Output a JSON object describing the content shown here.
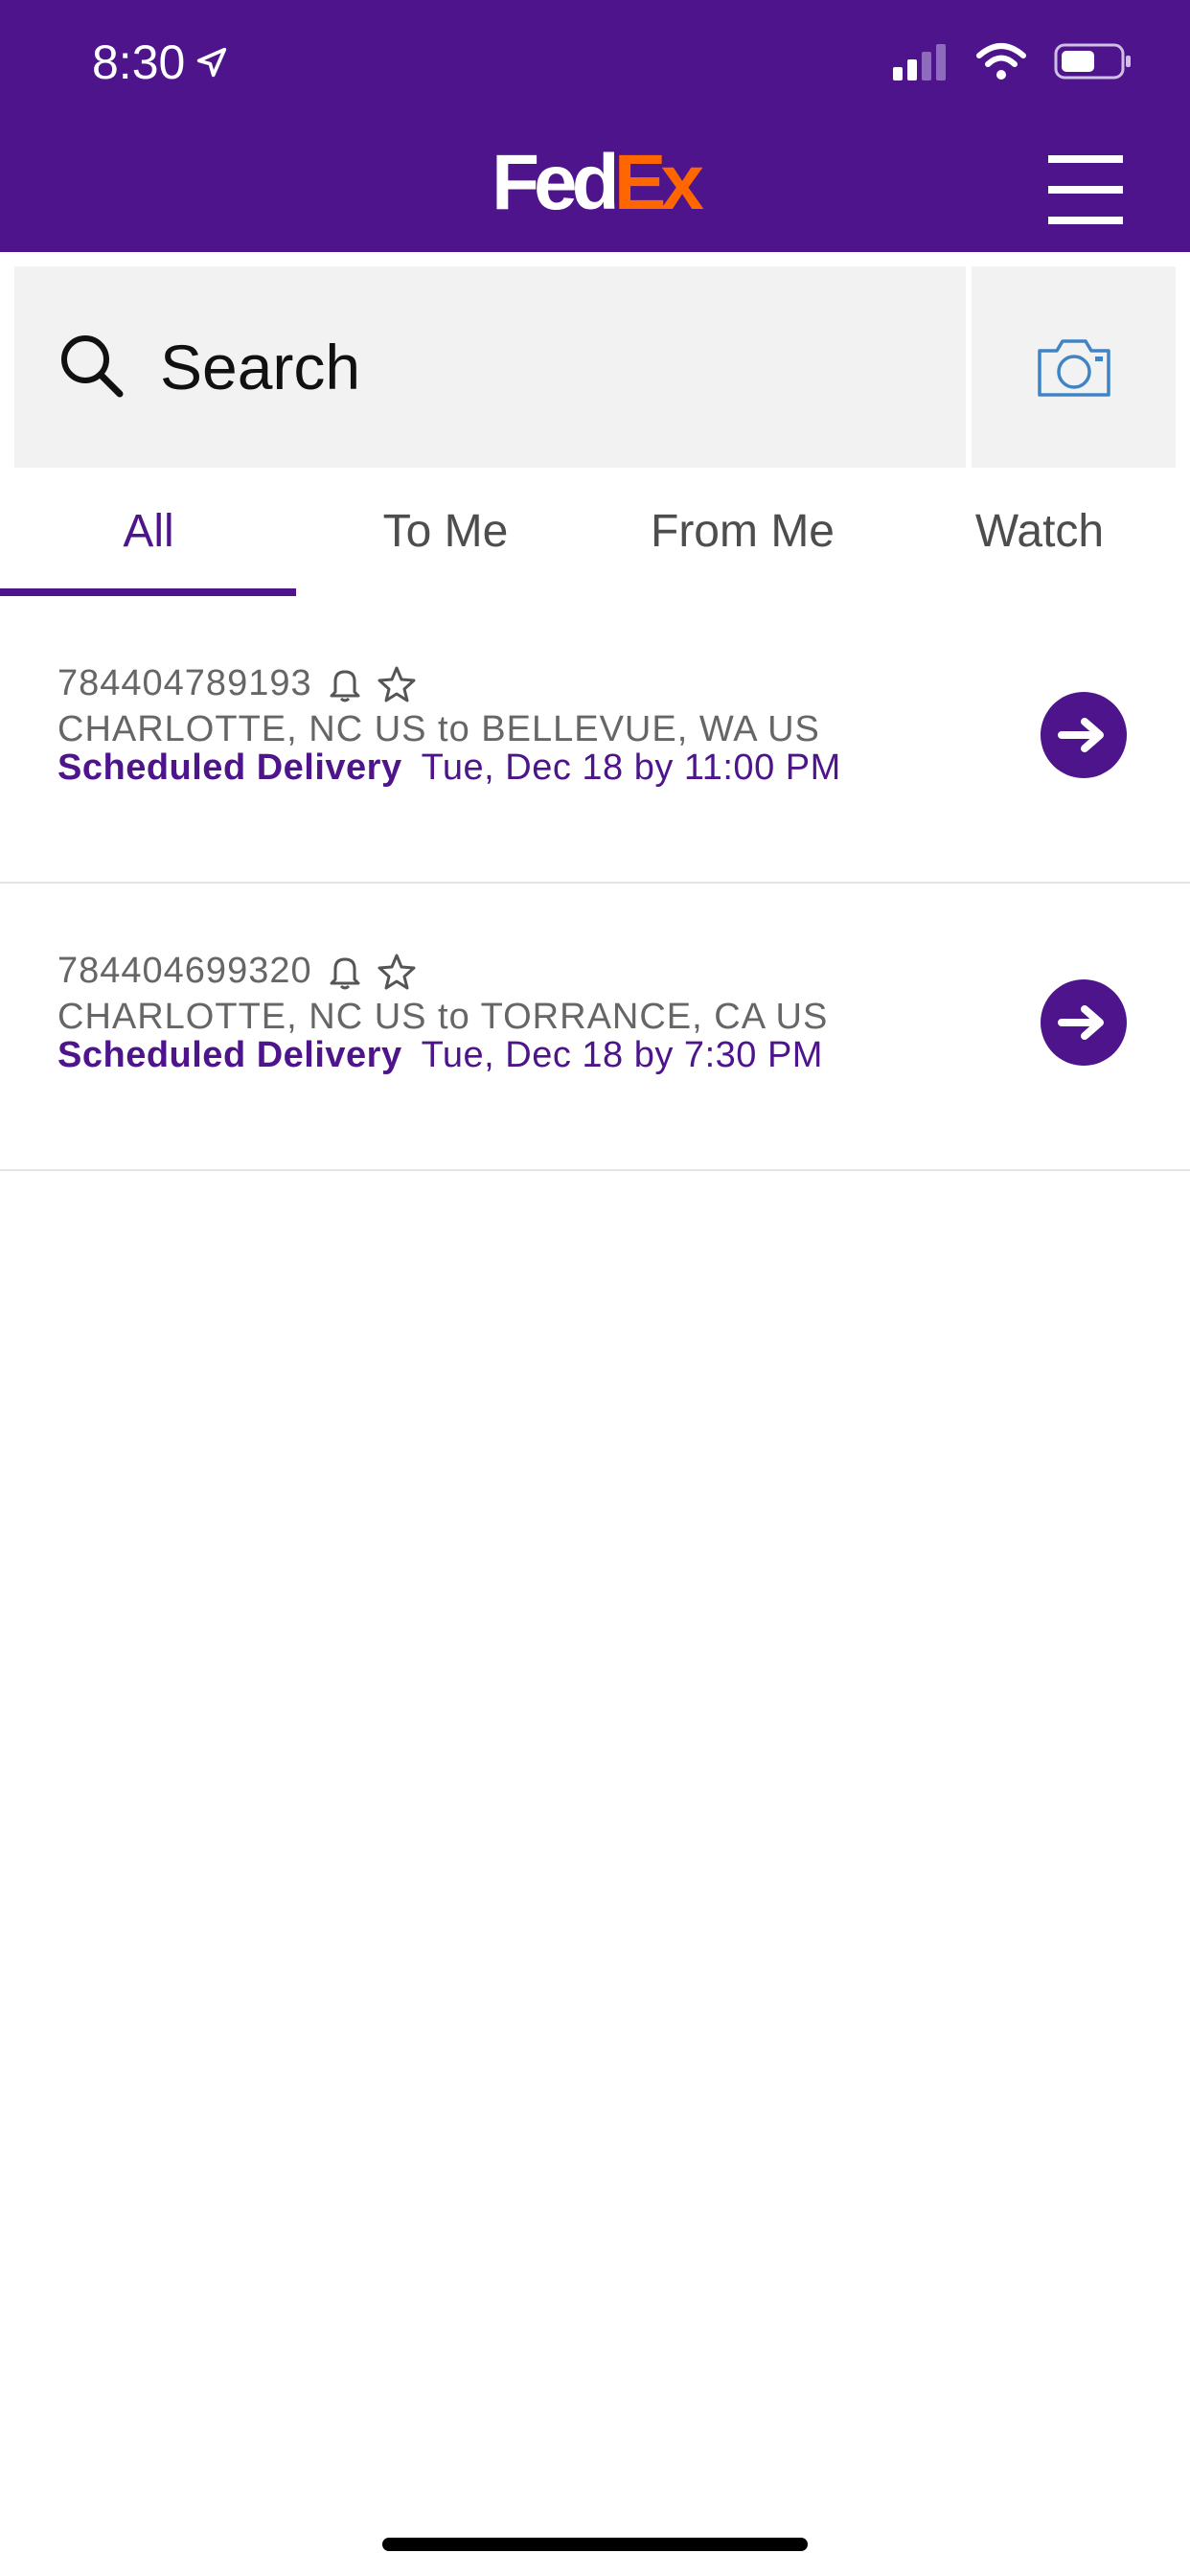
{
  "status_bar": {
    "time": "8:30"
  },
  "header": {
    "logo_fed": "Fed",
    "logo_ex": "Ex",
    "brand_purple": "#4d148c",
    "brand_orange": "#ff6600"
  },
  "search": {
    "placeholder": "Search"
  },
  "tabs": [
    {
      "label": "All",
      "active": true
    },
    {
      "label": "To Me",
      "active": false
    },
    {
      "label": "From Me",
      "active": false
    },
    {
      "label": "Watch",
      "active": false
    }
  ],
  "shipments": [
    {
      "tracking": "784404789193",
      "route": "CHARLOTTE, NC US to BELLEVUE, WA US",
      "status": "Scheduled Delivery",
      "when": "Tue, Dec 18 by 11:00 PM"
    },
    {
      "tracking": "784404699320",
      "route": "CHARLOTTE, NC US to TORRANCE, CA US",
      "status": "Scheduled Delivery",
      "when": "Tue, Dec 18 by 7:30 PM"
    }
  ]
}
